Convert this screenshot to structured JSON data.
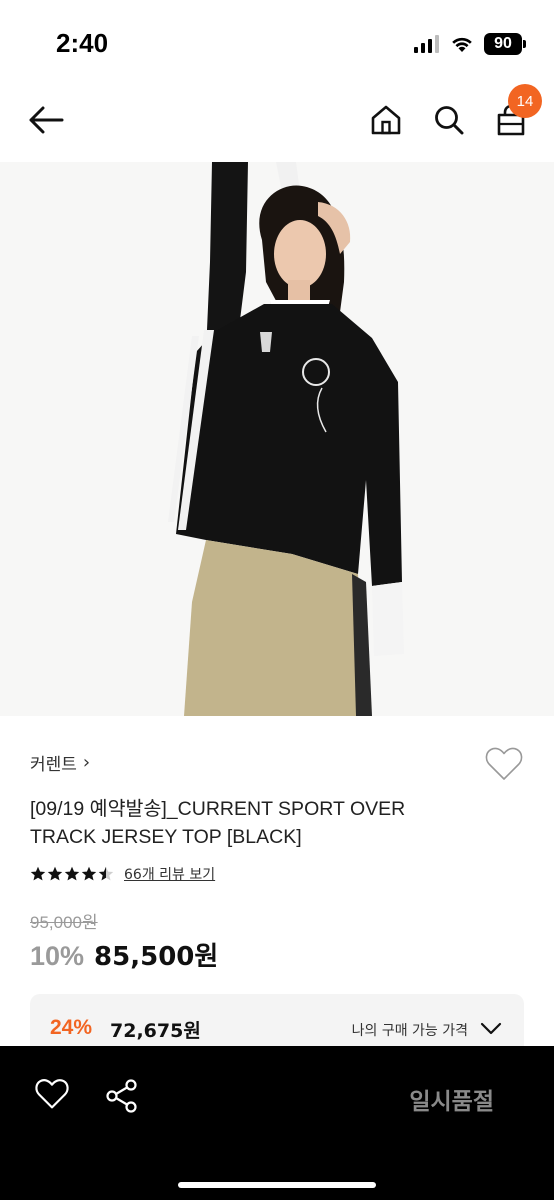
{
  "status_bar": {
    "time": "2:40",
    "battery": "90"
  },
  "nav": {
    "cart_count": "14",
    "icons": [
      "back-arrow-icon",
      "home-icon",
      "search-icon",
      "shopping-bag-icon"
    ]
  },
  "hero": {
    "image": "model-wearing-black-track-jersey-photo"
  },
  "product": {
    "brand": "커렌트",
    "brand_chevron": "›",
    "title": "[09/19 예약발송]_CURRENT SPORT OVER TRACK JERSEY TOP [BLACK]",
    "rating": 4.5,
    "review_link": "66개 리뷰 보기",
    "original_price": "95,000원",
    "discount": "10%",
    "sale_price": "85,500원"
  },
  "my_price": {
    "discount": "24%",
    "price": "72,675원",
    "label": "나의 구매 가능 가격"
  },
  "bottom_bar": {
    "action_label": "일시품절"
  },
  "colors": {
    "accent": "#f26522",
    "bottom_bar_bg": "#000000",
    "muted_text": "#9a9a9a",
    "price_box_bg": "#f4f4f4"
  }
}
